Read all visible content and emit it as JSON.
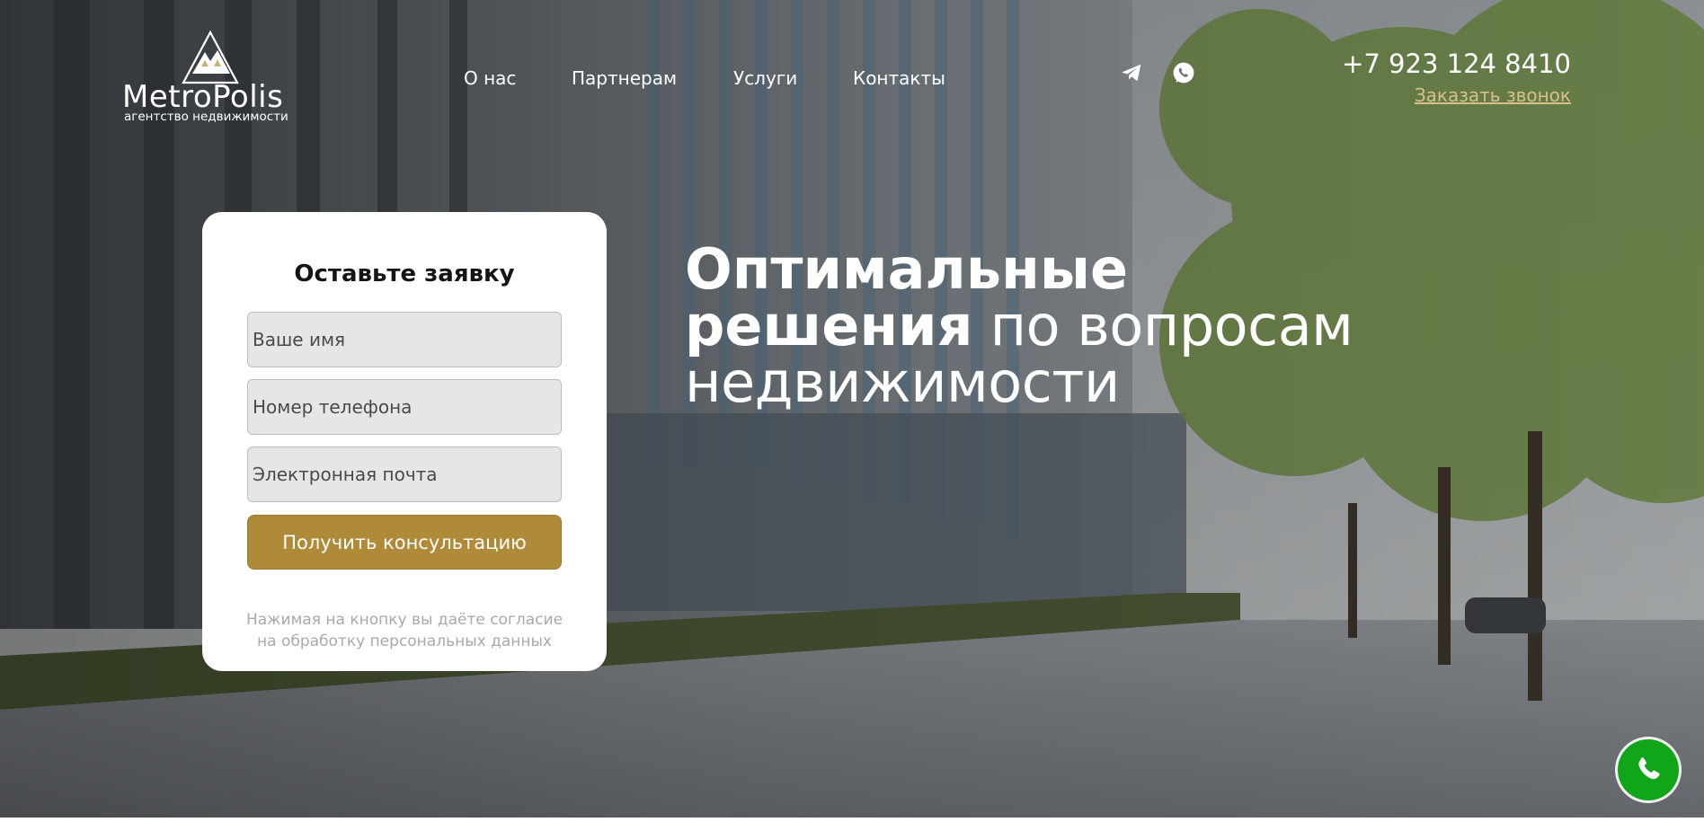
{
  "brand": {
    "name": "MetroPolis",
    "tagline": "агентство недвижимости"
  },
  "nav": {
    "items": [
      {
        "label": "О нас"
      },
      {
        "label": "Партнерам"
      },
      {
        "label": "Услуги"
      },
      {
        "label": "Контакты"
      }
    ]
  },
  "social": {
    "telegram_icon": "telegram-icon",
    "whatsapp_icon": "whatsapp-icon"
  },
  "contact": {
    "phone": "+7 923 124 8410",
    "callback_label": "Заказать звонок"
  },
  "form": {
    "title": "Оставьте заявку",
    "name_placeholder": "Ваше имя",
    "phone_placeholder": "Номер телефона",
    "email_placeholder": "Электронная почта",
    "submit_label": "Получить консультацию",
    "consent_line1": "Нажимая на кнопку вы даёте согласие",
    "consent_line2": "на обработку персональных данных"
  },
  "headline": {
    "bold_line1": "Оптимальные",
    "bold_line2": "решения",
    "light_line2": " по вопросам",
    "light_line3": "недвижимости"
  },
  "call_button": {
    "icon": "phone-icon"
  },
  "colors": {
    "accent": "#af8a38",
    "callback_link": "#d9c08a",
    "call_button": "#11a51a"
  }
}
